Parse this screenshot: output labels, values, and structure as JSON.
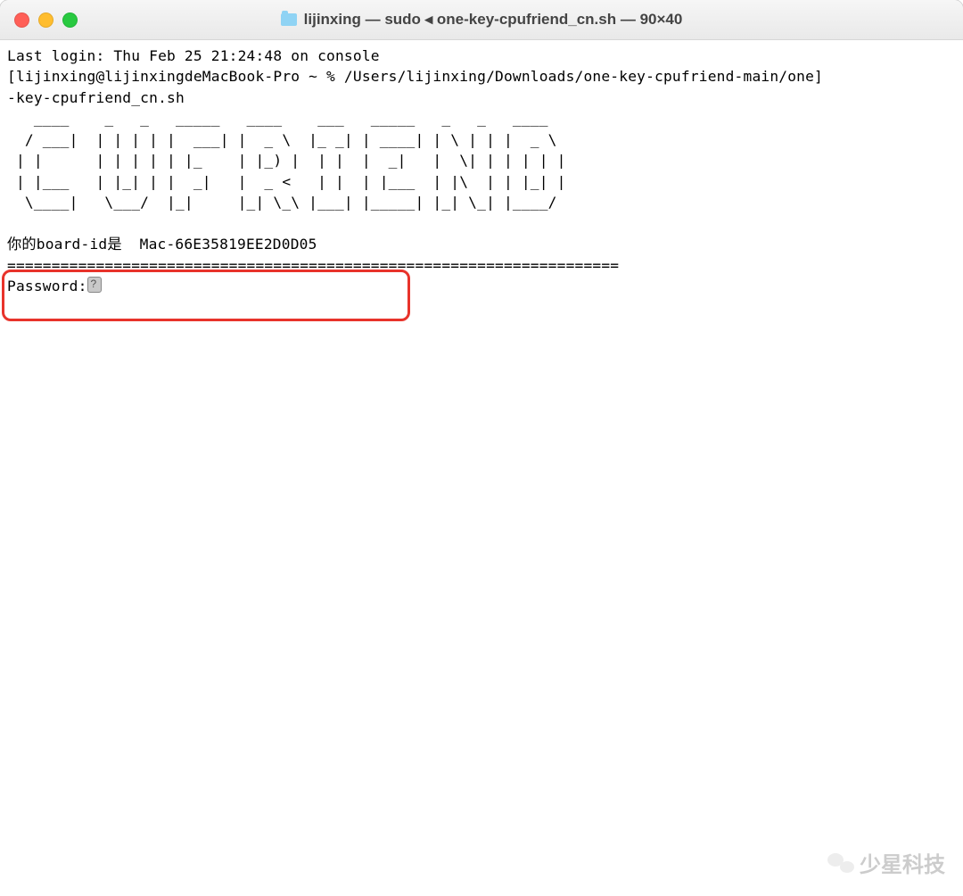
{
  "titlebar": {
    "title": "lijinxing — sudo ◂ one-key-cpufriend_cn.sh — 90×40"
  },
  "terminal": {
    "last_login": "Last login: Thu Feb 25 21:24:48 on console",
    "prompt_line1": "[lijinxing@lijinxingdeMacBook-Pro ~ % /Users/lijinxing/Downloads/one-key-cpufriend-main/one]",
    "prompt_line2": "-key-cpufriend_cn.sh",
    "ascii_art": "  ____    _   _ _____ ____  ___ _____ _   _ ____\n / ___|  | | | |  ___|  _ \\|_ _| ____| \\ | |  _ \\\n| |   | || | | | |_  | |_) || ||  _| |  \\| | | | |\n| |___|  _/| |_| |  _| |  _ < | || |___| |\\  | |_| |\n \\____| |_|   \\___/|_|   |_| \\_\\___|_____|_| \\_|____/",
    "board_id_line": "你的board-id是  Mac-66E35819EE2D0D05",
    "divider": "=====================================================================",
    "password_prompt": "Password:"
  },
  "watermark": {
    "text": "少星科技"
  }
}
